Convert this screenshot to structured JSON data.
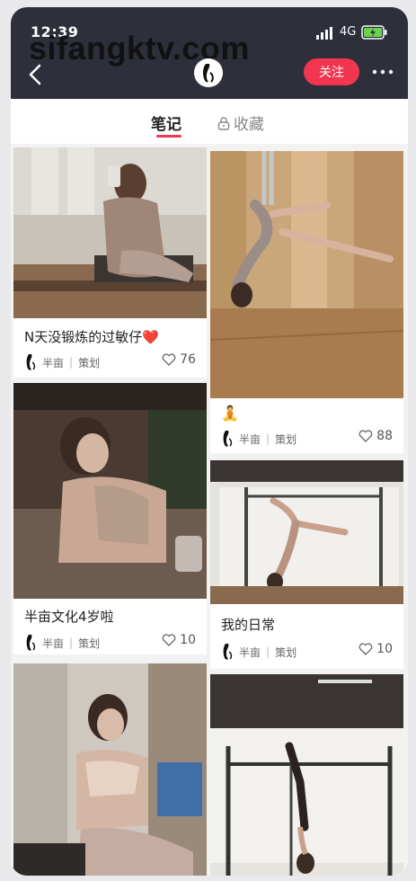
{
  "status_bar": {
    "time": "12:39",
    "network": "4G"
  },
  "watermark": "sifangktv.com",
  "header": {
    "follow_label": "关注"
  },
  "tabs": [
    {
      "label": "笔记"
    },
    {
      "label": "收藏"
    }
  ],
  "notes": [
    {
      "title": "N天没锻炼的过敏仔❤️",
      "author": "半亩",
      "tag": "策划",
      "likes": "76"
    },
    {
      "title": "",
      "emoji": "🧘",
      "author": "半亩",
      "tag": "策划",
      "likes": "88"
    },
    {
      "title": "半亩文化4岁啦",
      "author": "半亩",
      "tag": "策划",
      "likes": "10"
    },
    {
      "title": "我的日常",
      "author": "半亩",
      "tag": "策划",
      "likes": "10"
    }
  ],
  "colors": {
    "accent": "#f3364f",
    "header_bg": "#2d2f3a"
  }
}
